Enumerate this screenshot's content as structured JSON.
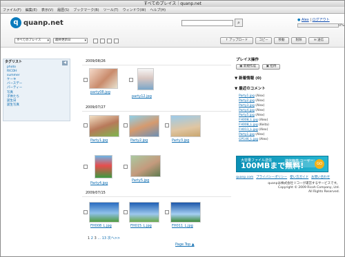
{
  "window": {
    "title": "すべてのプレイス｜quanp.net"
  },
  "menubar": [
    "ファイル(F)",
    "編集(E)",
    "表示(V)",
    "履歴(S)",
    "ブックマーク(B)",
    "ツール(T)",
    "ウィンドウ(W)",
    "ヘルプ(H)"
  ],
  "header": {
    "logo_mark": "q",
    "logo_text": "quanp.net",
    "search_placeholder": "",
    "user": "Alex",
    "logout": "ログアウト",
    "usage": "0%",
    "usage_fraction": 0
  },
  "toolbar": {
    "place_select": "すべてのプレイス",
    "sort_select": "最終更新日",
    "buttons": [
      "アップロード",
      "コピー",
      "移動",
      "削除",
      "送信"
    ]
  },
  "sidebar": {
    "title": "タグリスト",
    "tags": [
      "photo",
      "RICOH",
      "summer",
      "ケーキ",
      "バースデー",
      "パーティー",
      "写真",
      "子供たち",
      "誕生日",
      "誕生写真"
    ]
  },
  "main": {
    "groups": [
      {
        "date": "2009/08/26",
        "items": [
          "party08.jpg",
          "party12.jpg"
        ]
      },
      {
        "date": "2009/07/27",
        "items": [
          "Party1.jpg",
          "Party2.jpg",
          "Party3.jpg",
          "Party4.jpg",
          "Party5.jpg"
        ]
      },
      {
        "date": "2009/07/15",
        "items": [
          "FH008_L.jpg",
          "FH015_L.jpg",
          "FH011_L.jpg"
        ]
      }
    ],
    "pager": {
      "current": "1",
      "pages": [
        "2",
        "3",
        "...",
        "13"
      ],
      "next": "次へ>>"
    },
    "page_top": "Page Top ▲"
  },
  "right": {
    "ops_title": "プレイス操作",
    "ops_buttons": [
      "新規作成",
      "招待"
    ],
    "news_title": "新着情報 (0)",
    "comments_title": "最近のコメント",
    "comments": [
      {
        "file": "Party1.jpg",
        "user": "(Alex)"
      },
      {
        "file": "Party2.jpg",
        "user": "(Alex)"
      },
      {
        "file": "Party3.jpg",
        "user": "(Alex)"
      },
      {
        "file": "Party4.jpg",
        "user": "(Alex)"
      },
      {
        "file": "Party5.jpg",
        "user": "(Alex)"
      },
      {
        "file": "FH008_L.jpg",
        "user": "(Alex)"
      },
      {
        "file": "FH008_L.jpg",
        "user": "(Keita)"
      },
      {
        "file": "FH011_L.jpg",
        "user": "(Alex)"
      },
      {
        "file": "Party1.jpg",
        "user": "(Alex)"
      },
      {
        "file": "GP146_L.jpg",
        "user": "(Alex)"
      }
    ],
    "banner": {
      "line1": "大容量ファイル送信",
      "line2": "100MBまで無料!",
      "line3": "送信簡単 ユーザー登録不要",
      "badge": "GO"
    },
    "footer_links": [
      "quanp.com",
      "プライバシーポリシー",
      "使い方ガイド",
      "お問い合わせ"
    ],
    "copyright_1": "quanpは株式会社リコーが運営するサービスです。",
    "copyright_2": "Copyright © 2009 Ricoh Company, Ltd.",
    "copyright_3": "All Rights Reserved."
  },
  "colors": {
    "accent": "#0a6bb0",
    "logo": "#0a7bbd"
  }
}
